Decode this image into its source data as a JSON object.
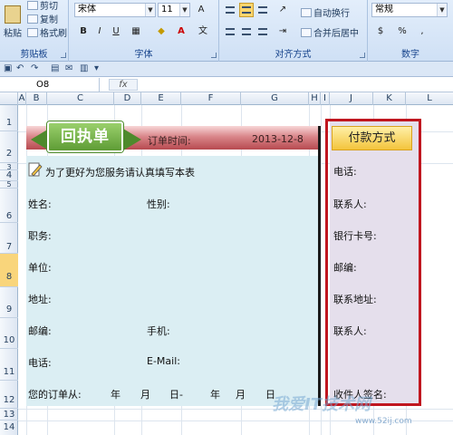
{
  "ribbon": {
    "clipboard": {
      "paste": "粘贴",
      "cut": "剪切",
      "copy": "复制",
      "format_painter": "格式刷",
      "label": "剪贴板"
    },
    "font": {
      "family": "宋体",
      "size": "11",
      "label": "字体",
      "bold": "B",
      "italic": "I",
      "underline": "U",
      "font_color_glyph": "A"
    },
    "alignment": {
      "wrap_text": "自动换行",
      "merge_center": "合并后居中",
      "label": "对齐方式"
    },
    "number": {
      "format": "常规",
      "percent": "%",
      "comma": ",",
      "label": "数字"
    }
  },
  "formula_bar": {
    "name_box": "O8",
    "fx": "fx"
  },
  "columns": [
    "A",
    "B",
    "C",
    "D",
    "E",
    "F",
    "G",
    "H",
    "I",
    "J",
    "K",
    "L"
  ],
  "rows": [
    "1",
    "2",
    "3",
    "4",
    "5",
    "6",
    "7",
    "8",
    "9",
    "10",
    "11",
    "12",
    "13",
    "14"
  ],
  "form": {
    "badge": "回执单",
    "order_time_label": "订单时间:",
    "order_date": "2013-12-8",
    "instruction": "为了更好为您服务请认真填写本表",
    "name": "姓名:",
    "gender": "性别:",
    "job": "职务:",
    "unit": "单位:",
    "address": "地址:",
    "zip": "邮编:",
    "mobile": "手机:",
    "phone": "电话:",
    "email": "E-Mail:",
    "order_from": "您的订单从:",
    "year1": "年",
    "month1": "月",
    "day1": "日-",
    "year2": "年",
    "month2": "月",
    "day2": "日"
  },
  "payment": {
    "title": "付款方式",
    "phone": "电话:",
    "contact": "联系人:",
    "bank_card": "银行卡号:",
    "zip": "邮编:",
    "contact_address": "联系地址:",
    "contact2": "联系人:",
    "signature": "收件人签名:"
  },
  "watermark": {
    "main": "我爱IT技术网",
    "url": "www.52ij.com"
  }
}
